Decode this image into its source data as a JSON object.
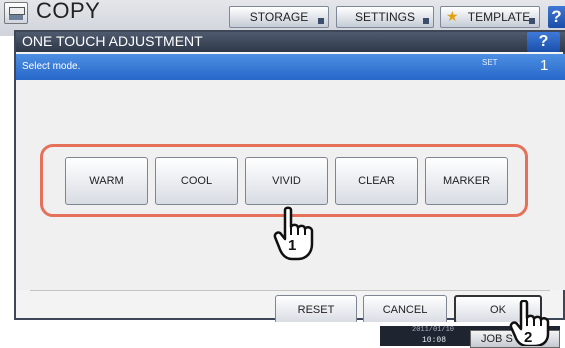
{
  "app": {
    "title": "COPY",
    "icon": "copier-icon"
  },
  "top_tabs": {
    "storage": "STORAGE",
    "settings": "SETTINGS",
    "template": "TEMPLATE",
    "help": "?"
  },
  "dialog": {
    "title": "ONE TOUCH ADJUSTMENT",
    "help": "?",
    "instruction": "Select mode.",
    "set_label": "SET",
    "set_count": "1"
  },
  "modes": [
    "WARM",
    "COOL",
    "VIVID",
    "CLEAR",
    "MARKER"
  ],
  "actions": {
    "reset": "RESET",
    "cancel": "CANCEL",
    "ok": "OK"
  },
  "status": {
    "date": "2011/01/10",
    "time": "10:08",
    "job_status": "JOB S"
  },
  "callouts": {
    "step1": "1",
    "step2": "2"
  },
  "colors": {
    "header": "#2e3849",
    "subheader": "#2767c8",
    "highlight": "#e6715a",
    "star": "#e0a010"
  }
}
